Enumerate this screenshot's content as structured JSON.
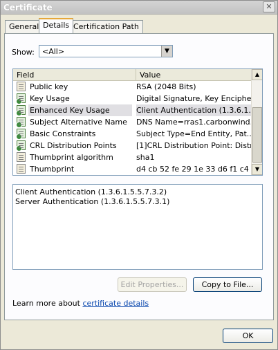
{
  "window": {
    "title": "Certificate",
    "close_glyph": "✕"
  },
  "tabs": [
    {
      "label": "General"
    },
    {
      "label": "Details"
    },
    {
      "label": "Certification Path"
    }
  ],
  "show": {
    "label": "Show:",
    "selected": "<All>",
    "arrow_glyph": "▼"
  },
  "list": {
    "columns": [
      "Field",
      "Value"
    ],
    "rows": [
      {
        "field": "Public key",
        "value": "RSA (2048 Bits)",
        "icon": "certificate-field-icon"
      },
      {
        "field": "Key Usage",
        "value": "Digital Signature, Key Encipher...",
        "icon": "certificate-extension-icon"
      },
      {
        "field": "Enhanced Key Usage",
        "value": "Client Authentication (1.3.6.1....",
        "icon": "certificate-extension-icon"
      },
      {
        "field": "Subject Alternative Name",
        "value": "DNS Name=rras1.carbonwind....",
        "icon": "certificate-extension-icon"
      },
      {
        "field": "Basic Constraints",
        "value": "Subject Type=End Entity, Pat...",
        "icon": "certificate-extension-icon"
      },
      {
        "field": "CRL Distribution Points",
        "value": "[1]CRL Distribution Point: Distr...",
        "icon": "certificate-extension-icon"
      },
      {
        "field": "Thumbprint algorithm",
        "value": "sha1",
        "icon": "certificate-field-icon"
      },
      {
        "field": "Thumbprint",
        "value": "d4 cb 52 fe 29 1e 33 d6 f1 c4 ...",
        "icon": "certificate-field-icon"
      }
    ],
    "scroll_up_glyph": "▲",
    "scroll_down_glyph": "▼"
  },
  "details": {
    "lines": [
      "Client Authentication (1.3.6.1.5.5.7.3.2)",
      "Server Authentication (1.3.6.1.5.5.7.3.1)"
    ]
  },
  "buttons": {
    "edit_properties": "Edit Properties...",
    "copy_to_file": "Copy to File...",
    "ok": "OK"
  },
  "learn_more": {
    "prefix": "Learn more about ",
    "link": "certificate details"
  }
}
